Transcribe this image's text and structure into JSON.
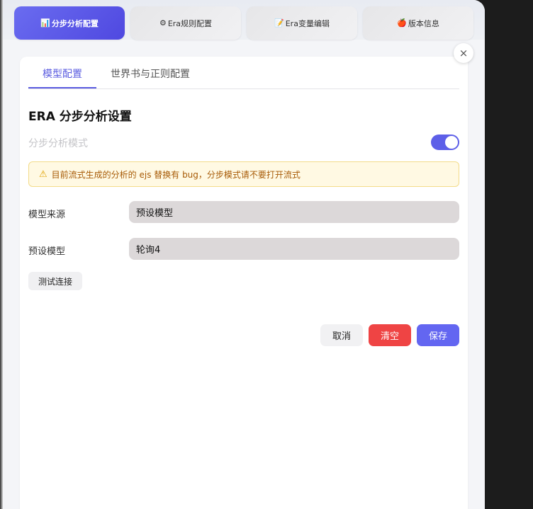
{
  "top_tabs": [
    {
      "icon": "📊",
      "label": "分步分析配置"
    },
    {
      "icon": "⚙",
      "label": "Era规则配置"
    },
    {
      "icon": "📝",
      "label": "Era变量编辑"
    },
    {
      "icon": "🍎",
      "label": "版本信息"
    }
  ],
  "close_symbol": "×",
  "sub_tabs": [
    "模型配置",
    "世界书与正则配置"
  ],
  "section_title": "ERA 分步分析设置",
  "mode": {
    "label": "分步分析模式",
    "enabled": true
  },
  "warning": {
    "icon": "⚠",
    "text": "目前流式生成的分析的 ejs 替换有 bug，分步模式请不要打开流式"
  },
  "fields": [
    {
      "label": "模型来源",
      "value": "预设模型"
    },
    {
      "label": "预设模型",
      "value": "轮询4"
    }
  ],
  "test_button": "测试连接",
  "actions": {
    "cancel": "取消",
    "clear": "清空",
    "save": "保存"
  },
  "colors": {
    "accent": "#5b5ce0",
    "danger": "#ef4444",
    "warning_bg": "#fff9e3"
  }
}
